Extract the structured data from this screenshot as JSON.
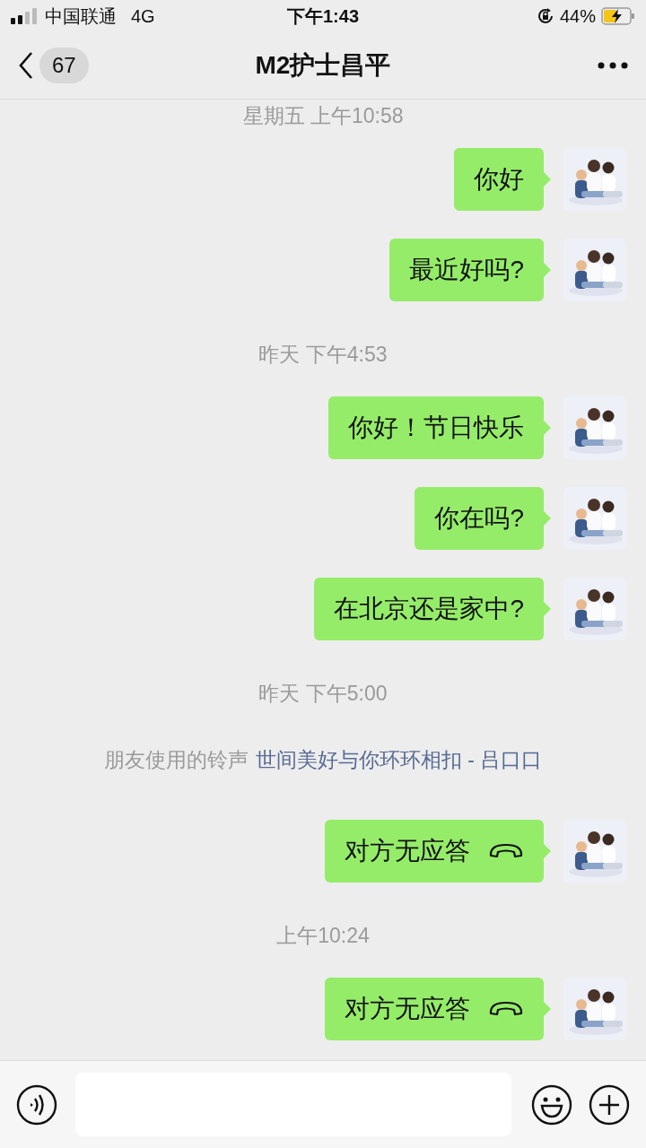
{
  "status_bar": {
    "carrier": "中国联通",
    "network": "4G",
    "time": "下午1:43",
    "battery": "44%"
  },
  "nav": {
    "badge": "67",
    "title": "M2护士昌平"
  },
  "messages": [
    {
      "kind": "time",
      "text": "星期五 上午10:58"
    },
    {
      "kind": "text",
      "text": "你好"
    },
    {
      "kind": "text",
      "text": "最近好吗?"
    },
    {
      "kind": "time",
      "text": "昨天 下午4:53"
    },
    {
      "kind": "text",
      "text": "你好！节日快乐"
    },
    {
      "kind": "text",
      "text": "你在吗?"
    },
    {
      "kind": "text",
      "text": "在北京还是家中?"
    },
    {
      "kind": "time",
      "text": "昨天 下午5:00"
    },
    {
      "kind": "notice",
      "text": "朋友使用的铃声",
      "link": "世间美好与你环环相扣 - 吕口口"
    },
    {
      "kind": "call",
      "text": "对方无应答"
    },
    {
      "kind": "time",
      "text": "上午10:24"
    },
    {
      "kind": "call",
      "text": "对方无应答"
    }
  ]
}
